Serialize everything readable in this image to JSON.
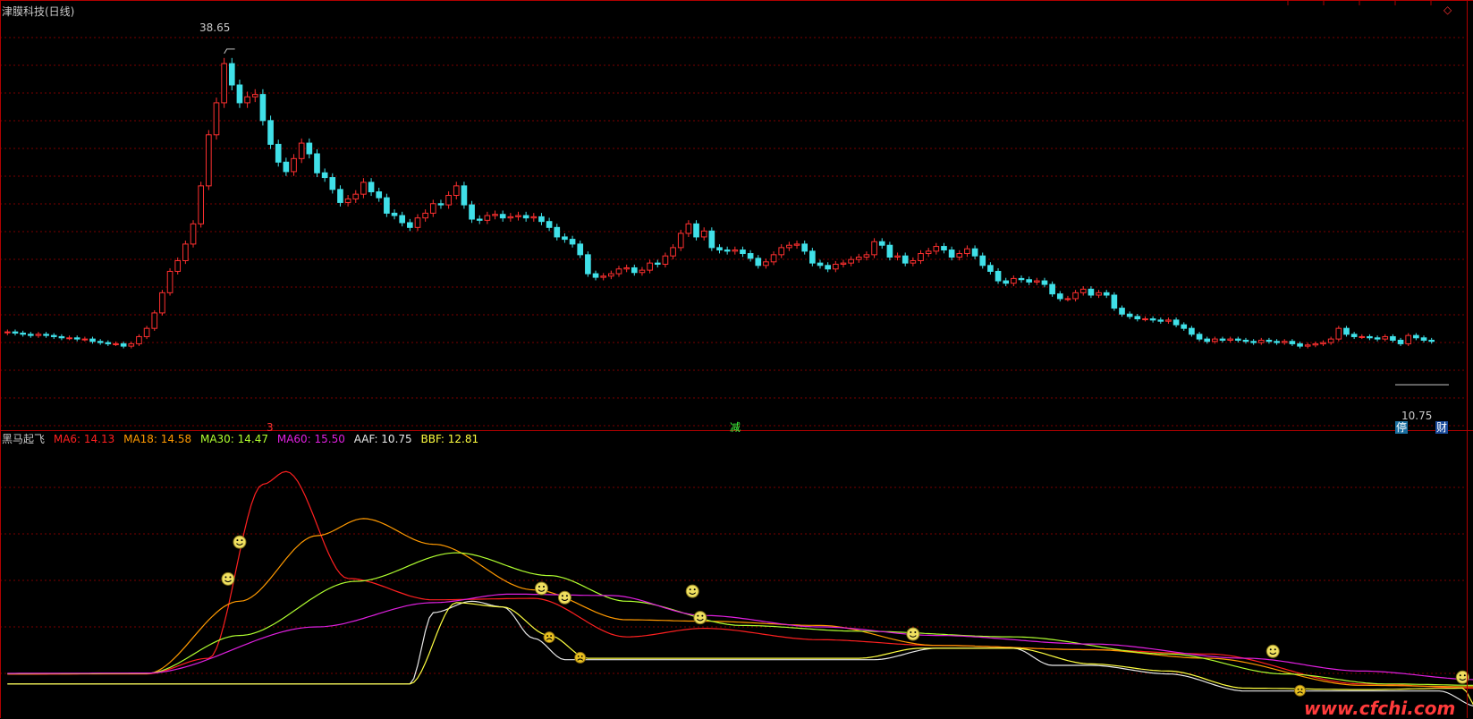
{
  "main_title": "津膜科技(日线)",
  "price_high": "38.65",
  "price_last": "10.75",
  "mark_three": "3",
  "mark_jian": "减",
  "badge_ting": "停",
  "badge_cai": "财",
  "window_ctrl": "◇",
  "watermark": "www.cfchi.com",
  "indicator": {
    "name": "黑马起飞",
    "items": [
      {
        "label": "MA6: 14.13",
        "color": "#ff2020"
      },
      {
        "label": "MA18: 14.58",
        "color": "#ff9900"
      },
      {
        "label": "MA30: 14.47",
        "color": "#b0ff30"
      },
      {
        "label": "MA60: 15.50",
        "color": "#e020e0"
      },
      {
        "label": "AAF: 10.75",
        "color": "#e8e8e8"
      },
      {
        "label": "BBF: 12.81",
        "color": "#ffff40"
      }
    ]
  },
  "colors": {
    "up": "#ff3030",
    "down": "#40e0e8",
    "grid": "#7a0000",
    "border": "#b00000",
    "smiley": "#f0e060"
  },
  "chart_data": [
    {
      "type": "candlestick",
      "title": "津膜科技(日线)",
      "ylim": [
        7.0,
        41.5
      ],
      "annotated_high": 38.65,
      "annotated_last": 10.75,
      "closes": [
        15.2,
        15.1,
        15.0,
        14.9,
        15.0,
        14.9,
        14.8,
        14.7,
        14.7,
        14.6,
        14.6,
        14.4,
        14.3,
        14.2,
        14.2,
        14.0,
        14.2,
        14.8,
        15.5,
        16.8,
        18.5,
        20.3,
        21.2,
        22.6,
        24.3,
        27.5,
        31.8,
        34.5,
        37.8,
        36.0,
        34.5,
        35.0,
        35.2,
        33.0,
        31.0,
        29.5,
        28.7,
        29.8,
        31.1,
        30.2,
        28.6,
        28.2,
        27.2,
        26.1,
        26.4,
        26.8,
        27.8,
        27.0,
        26.5,
        25.2,
        25.0,
        24.4,
        24.0,
        24.8,
        25.2,
        26.0,
        25.9,
        26.7,
        27.5,
        25.9,
        24.7,
        24.6,
        25.0,
        25.1,
        24.8,
        24.9,
        25.0,
        24.8,
        24.9,
        24.5,
        24.0,
        23.2,
        23.0,
        22.6,
        21.7,
        20.1,
        19.8,
        19.9,
        20.1,
        20.5,
        20.6,
        20.2,
        20.4,
        21.0,
        20.9,
        21.6,
        22.3,
        23.5,
        24.3,
        23.2,
        23.7,
        22.3,
        22.1,
        22.0,
        22.1,
        21.8,
        21.4,
        20.8,
        21.1,
        21.7,
        22.3,
        22.5,
        22.6,
        22.0,
        21.0,
        20.8,
        20.5,
        20.9,
        21.0,
        21.3,
        21.5,
        21.7,
        22.8,
        22.5,
        21.5,
        21.6,
        21.0,
        21.2,
        21.8,
        22.0,
        22.4,
        22.1,
        21.5,
        21.8,
        22.2,
        21.6,
        20.8,
        20.3,
        19.5,
        19.3,
        19.7,
        19.6,
        19.4,
        19.5,
        19.2,
        18.4,
        18.0,
        18.0,
        18.5,
        18.8,
        18.3,
        18.5,
        18.3,
        17.2,
        16.7,
        16.5,
        16.3,
        16.3,
        16.2,
        16.1,
        16.2,
        15.8,
        15.5,
        15.0,
        14.6,
        14.4,
        14.6,
        14.5,
        14.6,
        14.5,
        14.4,
        14.3,
        14.5,
        14.4,
        14.3,
        14.4,
        14.2,
        14.0,
        14.1,
        14.2,
        14.3,
        14.6,
        15.5,
        15.0,
        14.8,
        14.8,
        14.7,
        14.6,
        14.8,
        14.5,
        14.2,
        14.9,
        14.7,
        14.5,
        14.4
      ]
    },
    {
      "type": "line",
      "title": "黑马起飞",
      "series": [
        {
          "name": "MA6",
          "final_value": 14.13,
          "points": [
            [
              0,
              0.94
            ],
            [
              18,
              0.95
            ],
            [
              26,
              1.5
            ],
            [
              33,
              7.6
            ],
            [
              36,
              8.05
            ],
            [
              44,
              4.3
            ],
            [
              55,
              3.55
            ],
            [
              68,
              3.6
            ],
            [
              80,
              2.25
            ],
            [
              90,
              2.55
            ],
            [
              105,
              2.15
            ],
            [
              120,
              1.95
            ],
            [
              140,
              1.8
            ],
            [
              155,
              1.65
            ],
            [
              175,
              0.6
            ],
            [
              190,
              0.45
            ]
          ]
        },
        {
          "name": "MA18",
          "final_value": 14.58,
          "points": [
            [
              0,
              0.95
            ],
            [
              18,
              0.96
            ],
            [
              30,
              3.5
            ],
            [
              40,
              5.8
            ],
            [
              46,
              6.4
            ],
            [
              55,
              5.5
            ],
            [
              68,
              3.9
            ],
            [
              80,
              2.85
            ],
            [
              90,
              2.8
            ],
            [
              105,
              2.65
            ],
            [
              120,
              1.95
            ],
            [
              140,
              1.8
            ],
            [
              155,
              1.5
            ],
            [
              175,
              0.55
            ],
            [
              190,
              0.5
            ]
          ]
        },
        {
          "name": "MA30",
          "final_value": 14.47,
          "points": [
            [
              0,
              0.96
            ],
            [
              18,
              0.97
            ],
            [
              30,
              2.3
            ],
            [
              45,
              4.2
            ],
            [
              58,
              5.2
            ],
            [
              70,
              4.4
            ],
            [
              80,
              3.5
            ],
            [
              95,
              2.65
            ],
            [
              110,
              2.45
            ],
            [
              130,
              2.25
            ],
            [
              150,
              1.65
            ],
            [
              165,
              0.95
            ],
            [
              178,
              0.6
            ],
            [
              190,
              0.55
            ]
          ]
        },
        {
          "name": "MA60",
          "final_value": 15.5,
          "points": [
            [
              0,
              0.97
            ],
            [
              18,
              0.98
            ],
            [
              40,
              2.6
            ],
            [
              55,
              3.45
            ],
            [
              65,
              3.75
            ],
            [
              78,
              3.7
            ],
            [
              90,
              3.0
            ],
            [
              105,
              2.6
            ],
            [
              120,
              2.3
            ],
            [
              140,
              2.0
            ],
            [
              160,
              1.5
            ],
            [
              175,
              1.05
            ],
            [
              190,
              0.75
            ]
          ]
        },
        {
          "name": "AAF",
          "final_value": 10.75,
          "points": [
            [
              0,
              0.6
            ],
            [
              18,
              0.6
            ],
            [
              52,
              0.6
            ],
            [
              55,
              3.1
            ],
            [
              60,
              3.5
            ],
            [
              64,
              3.3
            ],
            [
              68,
              2.2
            ],
            [
              72,
              1.45
            ],
            [
              85,
              1.45
            ],
            [
              112,
              1.45
            ],
            [
              120,
              1.85
            ],
            [
              130,
              1.85
            ],
            [
              135,
              1.25
            ],
            [
              140,
              1.25
            ],
            [
              150,
              0.95
            ],
            [
              160,
              0.35
            ],
            [
              175,
              0.35
            ],
            [
              185,
              0.35
            ],
            [
              190,
              -0.2
            ]
          ]
        },
        {
          "name": "BBF",
          "final_value": 12.81,
          "points": [
            [
              0,
              0.6
            ],
            [
              18,
              0.6
            ],
            [
              52,
              0.6
            ],
            [
              58,
              3.45
            ],
            [
              64,
              3.3
            ],
            [
              70,
              2.3
            ],
            [
              75,
              1.5
            ],
            [
              110,
              1.5
            ],
            [
              118,
              1.85
            ],
            [
              130,
              1.85
            ],
            [
              140,
              1.3
            ],
            [
              150,
              1.05
            ],
            [
              160,
              0.45
            ],
            [
              175,
              0.4
            ],
            [
              188,
              0.45
            ],
            [
              190,
              -0.3
            ]
          ]
        }
      ],
      "signals": [
        28.5,
        30,
        69,
        72,
        88.5,
        89.5,
        117,
        163.5,
        188
      ],
      "alerts": [
        70,
        74,
        167
      ]
    }
  ]
}
